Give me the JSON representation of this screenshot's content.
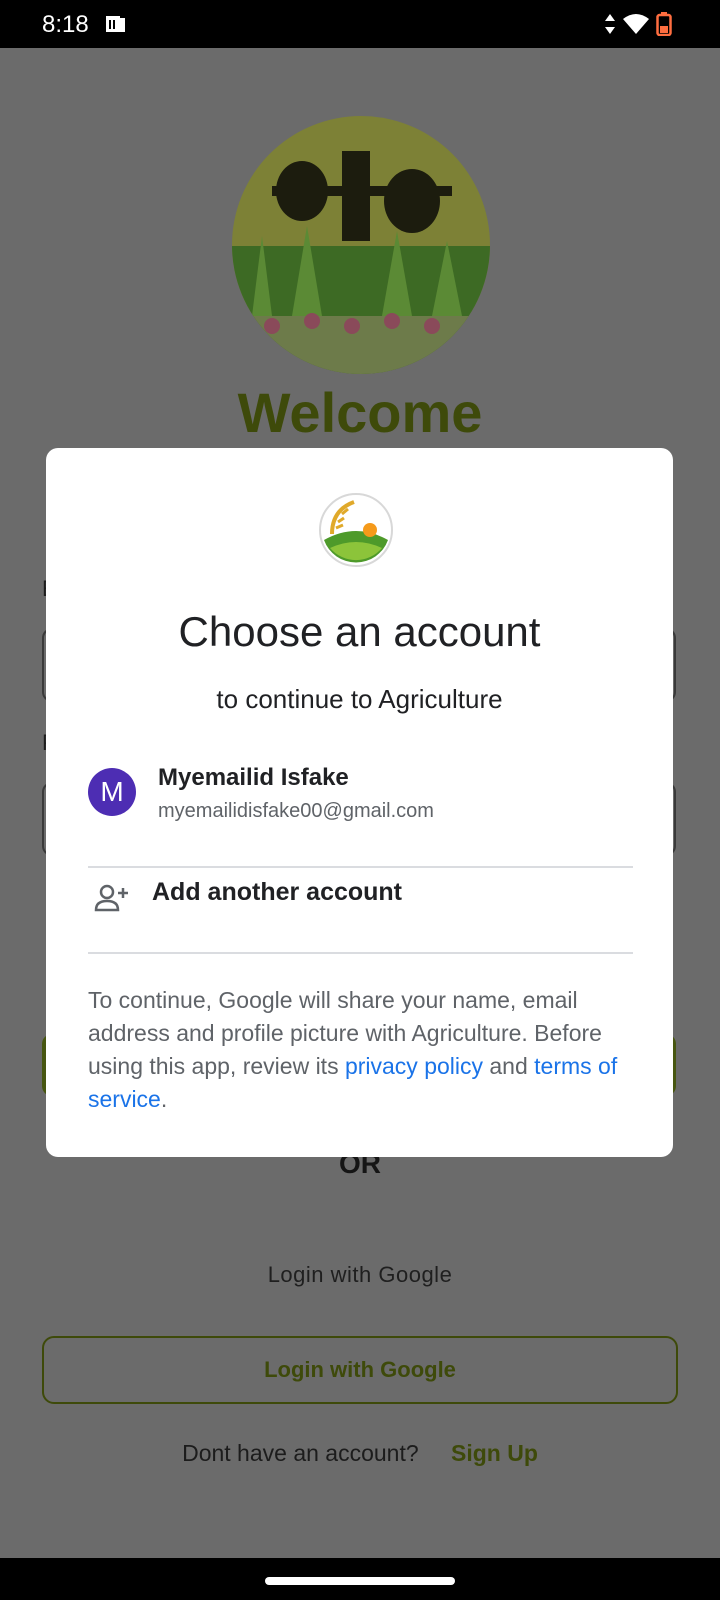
{
  "status_bar": {
    "time": "8:18"
  },
  "background": {
    "welcome": "Welcome",
    "or_text": "OR",
    "login_with_google_text": "Login with Google",
    "login_with_google_button": "Login with Google",
    "no_account_text": "Dont have an account?",
    "signup_label": "Sign Up"
  },
  "dialog": {
    "title": "Choose an account",
    "subtitle": "to continue to Agriculture",
    "account": {
      "initial": "M",
      "name": "Myemailid Isfake",
      "email": "myemailidisfake00@gmail.com"
    },
    "add_account_label": "Add another account",
    "disclaimer": {
      "part1": "To continue, Google will share your name, email address and profile picture with Agriculture. Before using this app, review its ",
      "privacy_link": "privacy policy",
      "part2": " and ",
      "terms_link": "terms of service",
      "part3": "."
    }
  },
  "colors": {
    "brand_green": "#3e4a0a",
    "link_blue": "#1a73e8",
    "avatar_purple": "#4d2db3"
  }
}
